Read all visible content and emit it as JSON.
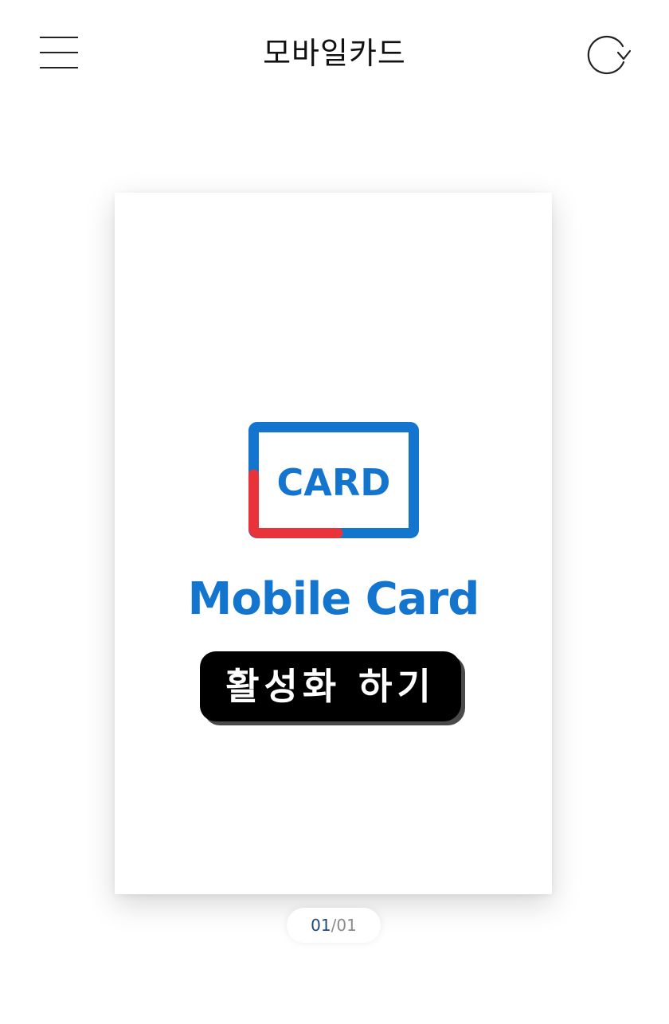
{
  "header": {
    "title": "모바일카드",
    "menu_icon": "hamburger-menu-icon",
    "refresh_icon": "refresh-icon"
  },
  "card": {
    "logo_text": "CARD",
    "brand_text": "Mobile Card",
    "activate_label": "활성화 하기",
    "colors": {
      "brand_blue": "#1475cf",
      "accent_red": "#e8333a",
      "button_bg": "#000000"
    }
  },
  "pager": {
    "current": "01",
    "separator": "/",
    "total": "01"
  }
}
